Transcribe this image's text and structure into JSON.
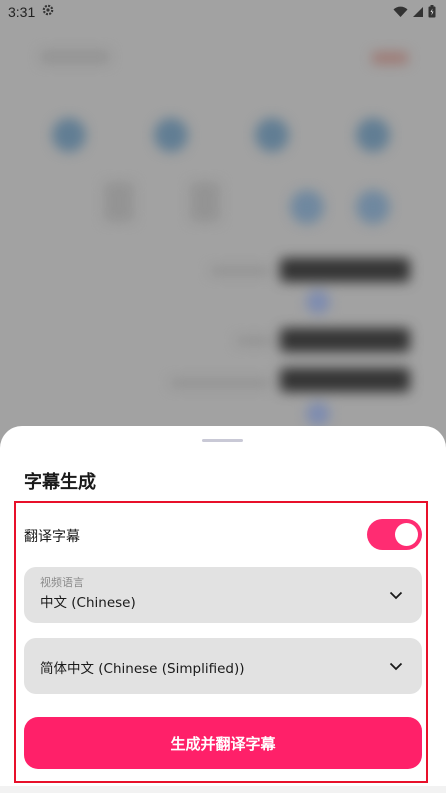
{
  "status_bar": {
    "time": "3:31",
    "icons": [
      "gear-icon",
      "wifi-icon",
      "signal-icon",
      "battery-icon"
    ]
  },
  "sheet": {
    "title": "字幕生成",
    "translate_toggle": {
      "label": "翻译字幕",
      "on": true
    },
    "video_language": {
      "label": "视频语言",
      "value": "中文 (Chinese)"
    },
    "target_language": {
      "value": "简体中文 (Chinese (Simplified))"
    },
    "generate_button": "生成并翻译字幕"
  },
  "colors": {
    "accent": "#ff2069",
    "highlight": "#e8102a",
    "field_bg": "#e2e2e2"
  }
}
